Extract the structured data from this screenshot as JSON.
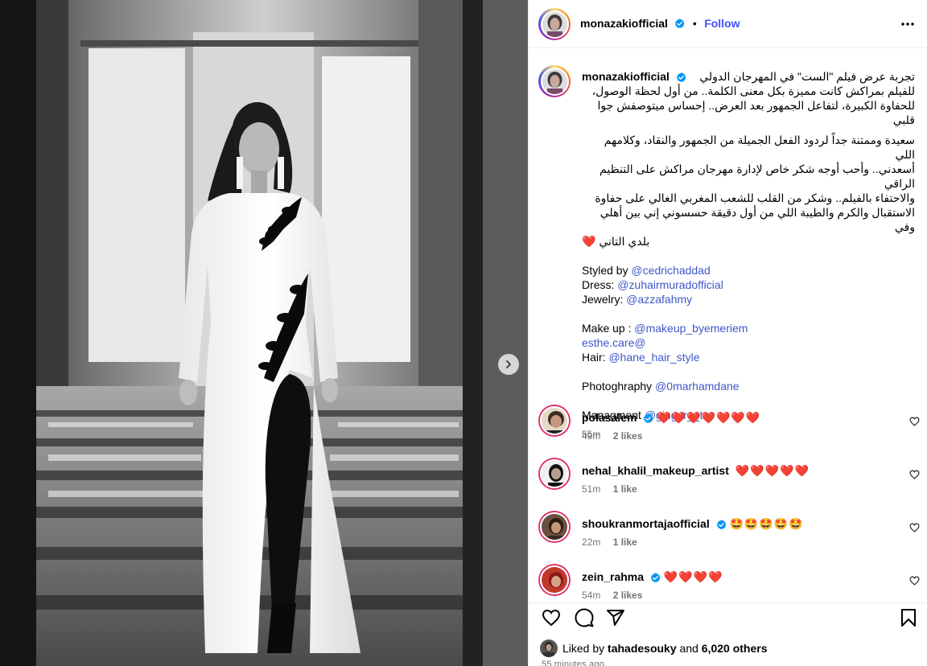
{
  "header": {
    "username": "monazakiofficial",
    "separator": "•",
    "follow_label": "Follow"
  },
  "caption": {
    "username": "monazakiofficial",
    "arabic_lines_1": [
      "تجربة عرض فيلم \"الست\" في المهرجان الدولي",
      "للفيلم بمراكش كانت مميزة بكل معنى الكلمة.. من أول لحظة الوصول،",
      "للحفاوة الكبيرة، لتفاعل الجمهور بعد العرض.. إحساس ميتوصفش جوا قلبي"
    ],
    "arabic_lines_2": [
      "سعيدة وممتنة جداً لردود الفعل الجميلة من الجمهور والنقاد، وكلامهم اللي",
      "أسعدني.. وأحب أوجه شكر خاص لإدارة مهرجان مراكش على التنظيم الراقي",
      "والاحتفاء بالفيلم.. وشكر من القلب للشعب المغربي الغالي على حفاوة",
      "الاستقبال والكرم والطيبة اللي من أول دقيقة حسسوني إني بين أهلي وفي",
      "بلدي التاني"
    ],
    "heart": "❤️",
    "styled_by_label": "Styled by",
    "styled_by": "@cedrichaddad",
    "dress_label": "Dress:",
    "dress": "@zuhairmuradofficial",
    "jewelry_label": "Jewelry:",
    "jewelry": "@azzafahmy",
    "makeup_label": "Make up :",
    "makeup": "@makeup_byemeriem",
    "esthe": "esthe.care@",
    "hair_label": "Hair:",
    "hair": "@hane_hair_style",
    "photo_label": "Photoghraphy",
    "photo": "@0marhamdane",
    "mgmt_label": "Managment",
    "mgmt": "@ginger__tm",
    "time": "55m"
  },
  "comments": [
    {
      "username": "polasalem",
      "verified": true,
      "text": "❤️❤️❤️❤️❤️❤️❤️",
      "time": "49m",
      "likes": "2 likes"
    },
    {
      "username": "nehal_khalil_makeup_artist",
      "verified": false,
      "text": "❤️❤️❤️❤️❤️",
      "time": "51m",
      "likes": "1 like"
    },
    {
      "username": "shoukranmortajaofficial",
      "verified": true,
      "text": "🤩🤩🤩🤩🤩",
      "time": "22m",
      "likes": "1 like"
    },
    {
      "username": "zein_rahma",
      "verified": true,
      "text": "❤️❤️❤️❤️",
      "time": "54m",
      "likes": "2 likes"
    }
  ],
  "footer": {
    "liked_prefix": "Liked by",
    "liked_user": "tahadesouky",
    "liked_and": "and",
    "liked_count": "6,020 others",
    "time_ago": "55 minutes ago"
  },
  "icons": {
    "verified": "verified-badge-icon",
    "more": "more-horizontal-icon",
    "like": "heart-outline-icon",
    "comment": "comment-bubble-icon",
    "share": "paper-plane-icon",
    "save": "bookmark-icon",
    "next": "chevron-right-icon"
  },
  "colors": {
    "link": "#3f57c8",
    "follow": "#4150f7",
    "verified": "#0095f6",
    "heart": "#e0245e",
    "muted": "#737373"
  }
}
